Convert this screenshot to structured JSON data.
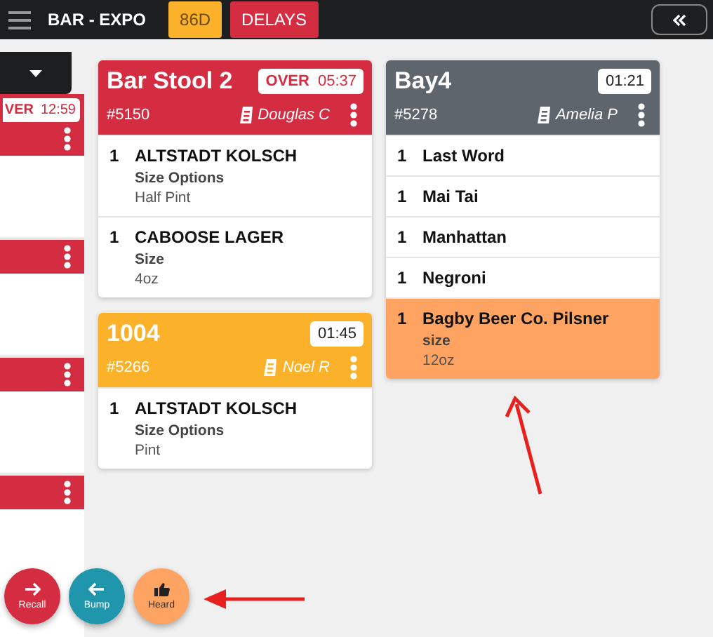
{
  "top_bar": {
    "title": "BAR - EXPO",
    "buttons": [
      {
        "label": "86D",
        "kind": "warning"
      },
      {
        "label": "DELAYS",
        "kind": "late"
      }
    ]
  },
  "left_column": {
    "cards": [
      {
        "color": "#d42c40",
        "over_label": "VER",
        "timer": "12:59"
      },
      {
        "color": "#d42c40"
      },
      {
        "color": "#d42c40"
      },
      {
        "color": "#d42c40"
      }
    ]
  },
  "columns": [
    {
      "cards": [
        {
          "title": "Bar Stool 2",
          "color": "#d42c40",
          "over_label": "OVER",
          "timer": "05:37",
          "ticket": "#5150",
          "server": "Douglas C",
          "items": [
            {
              "qty": "1",
              "name": "ALTSTADT KOLSCH",
              "modifier_label": "Size Options",
              "modifier_value": "Half Pint",
              "highlighted": false
            },
            {
              "qty": "1",
              "name": "CABOOSE LAGER",
              "modifier_label": "Size",
              "modifier_value": "4oz",
              "highlighted": false
            }
          ]
        },
        {
          "title": "1004",
          "color": "#fbb22a",
          "timer": "01:45",
          "ticket": "#5266",
          "server": "Noel R",
          "items": [
            {
              "qty": "1",
              "name": "ALTSTADT KOLSCH",
              "modifier_label": "Size Options",
              "modifier_value": "Pint",
              "highlighted": false
            }
          ]
        }
      ]
    },
    {
      "cards": [
        {
          "title": "Bay4",
          "color": "#5f656c",
          "timer": "01:21",
          "ticket": "#5278",
          "server": "Amelia P",
          "items": [
            {
              "qty": "1",
              "name": "Last Word",
              "highlighted": false
            },
            {
              "qty": "1",
              "name": "Mai Tai",
              "highlighted": false
            },
            {
              "qty": "1",
              "name": "Manhattan",
              "highlighted": false
            },
            {
              "qty": "1",
              "name": "Negroni",
              "highlighted": false
            },
            {
              "qty": "1",
              "name": "Bagby Beer Co. Pilsner",
              "modifier_label": "size",
              "modifier_value": "12oz",
              "highlighted": true
            }
          ]
        }
      ]
    }
  ],
  "action_buttons": [
    {
      "label": "Recall",
      "kind": "recall"
    },
    {
      "label": "Bump",
      "kind": "bump"
    },
    {
      "label": "Heard",
      "kind": "heard"
    }
  ]
}
